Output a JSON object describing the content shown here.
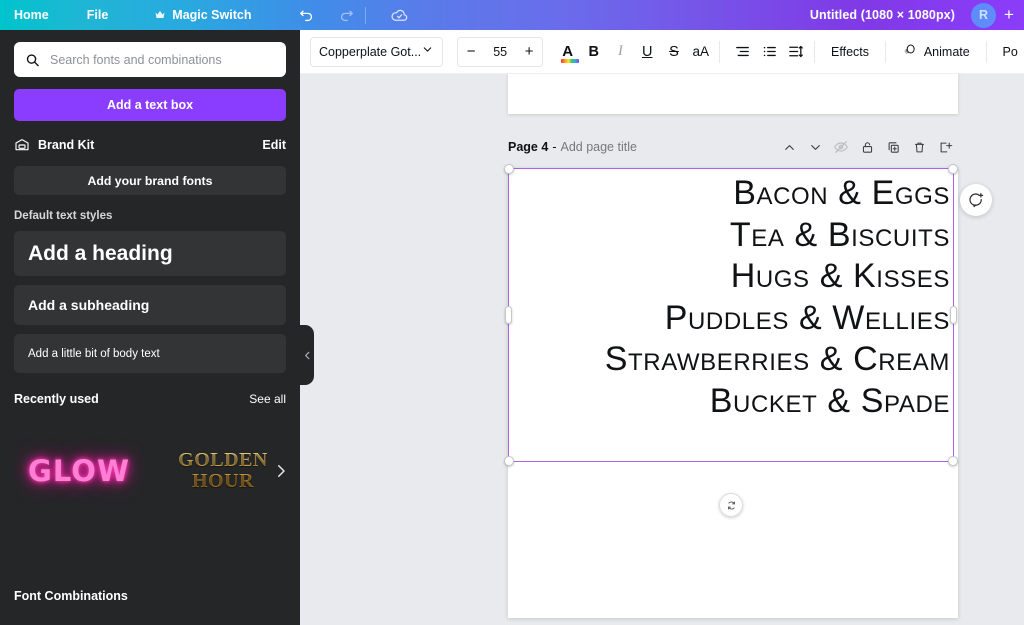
{
  "topbar": {
    "home": "Home",
    "file": "File",
    "magic_switch": "Magic Switch",
    "magic_icon": "crown-icon",
    "undo_icon": "undo-icon",
    "redo_icon": "redo-icon",
    "cloud_icon": "cloud-saved-icon",
    "doc_title": "Untitled (1080 × 1080px)",
    "avatar_initial": "R",
    "plus_label": "+",
    "gradient_start": "#00c4cc",
    "gradient_end": "#8b3dff"
  },
  "sidebar": {
    "search": {
      "placeholder": "Search fonts and combinations",
      "icon": "search-icon"
    },
    "add_text_box": "Add a text box",
    "brand_kit": {
      "label": "Brand Kit",
      "edit": "Edit",
      "icon": "brand-kit-icon"
    },
    "add_brand_fonts": "Add your brand fonts",
    "default_styles_label": "Default text styles",
    "styles": [
      {
        "label": "Add a heading"
      },
      {
        "label": "Add a subheading"
      },
      {
        "label": "Add a little bit of body text"
      }
    ],
    "recently_used": {
      "label": "Recently used",
      "see_all": "See all",
      "items": [
        {
          "label": "GLOW",
          "style": "neon-pink"
        },
        {
          "label": "GOLDEN HOUR",
          "style": "gold-serif"
        }
      ],
      "next_icon": "chevron-right-icon"
    },
    "font_combinations": "Font Combinations",
    "collapse_icon": "chevron-left-icon",
    "accent_color": "#8b3dff",
    "background": "#252627"
  },
  "toolbar": {
    "font_name": "Copperplate Got...",
    "font_dropdown_icon": "chevron-down-icon",
    "size_decrease": "−",
    "font_size": "55",
    "size_increase": "+",
    "text_color": {
      "label": "A",
      "icon": "text-color-icon"
    },
    "bold": "B",
    "italic": "I",
    "underline": "U",
    "strikethrough": "S",
    "letter_case": "aA",
    "align_icon": "align-right-icon",
    "list_icon": "bullet-list-icon",
    "spacing_icon": "line-spacing-icon",
    "effects": "Effects",
    "animate": "Animate",
    "animate_icon": "animate-icon",
    "position": "Po"
  },
  "canvas": {
    "page_label": "Page 4",
    "page_separator": "-",
    "page_title_placeholder": "Add page title",
    "header_icons": [
      {
        "name": "move-up-icon",
        "dim": false
      },
      {
        "name": "move-down-icon",
        "dim": false
      },
      {
        "name": "hide-page-icon",
        "dim": true
      },
      {
        "name": "lock-icon",
        "dim": false
      },
      {
        "name": "duplicate-page-icon",
        "dim": false
      },
      {
        "name": "delete-page-icon",
        "dim": false
      },
      {
        "name": "add-page-icon",
        "dim": false
      }
    ],
    "text_lines": [
      "Bacon & Eggs",
      "Tea & Biscuits",
      "Hugs & Kisses",
      "Puddles & Wellies",
      "Strawberries & Cream",
      "Bucket & Spade"
    ],
    "selection_color": "#ab61e8",
    "rotate_icon": "rotate-icon",
    "comment_icon": "add-comment-icon"
  }
}
